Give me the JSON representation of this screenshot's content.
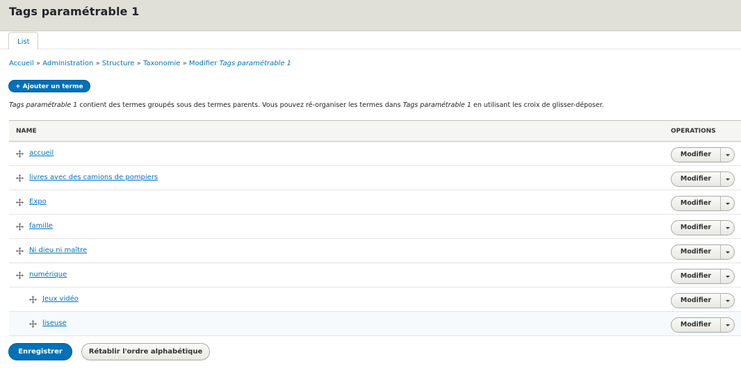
{
  "page": {
    "title": "Tags paramétrable 1"
  },
  "tabs": [
    {
      "label": "List"
    }
  ],
  "breadcrumb": {
    "items": [
      "Accueil",
      "Administration",
      "Structure",
      "Taxonomie",
      "Modifier"
    ],
    "separator": "»",
    "current": "Tags paramétrable 1"
  },
  "actions": {
    "add_term_label": "+ Ajouter un terme"
  },
  "description": {
    "vocab": "Tags paramétrable 1",
    "part1": " contient des termes groupés sous des termes parents. Vous pouvez ré-organiser les termes dans ",
    "part2": " en utilisant les croix de glisser-déposer."
  },
  "table": {
    "headers": {
      "name": "NAME",
      "operations": "OPERATIONS"
    },
    "rows": [
      {
        "name": "accueil",
        "depth": 0,
        "op": "Modifier"
      },
      {
        "name": "livres avec des camions de pompiers",
        "depth": 0,
        "op": "Modifier"
      },
      {
        "name": "Expo",
        "depth": 0,
        "op": "Modifier"
      },
      {
        "name": "famille",
        "depth": 0,
        "op": "Modifier"
      },
      {
        "name": "Ni dieu ni maître",
        "depth": 0,
        "op": "Modifier"
      },
      {
        "name": "numérique",
        "depth": 0,
        "op": "Modifier"
      },
      {
        "name": "Jeux vidéo",
        "depth": 1,
        "op": "Modifier"
      },
      {
        "name": "liseuse",
        "depth": 1,
        "op": "Modifier"
      }
    ]
  },
  "footer": {
    "save_label": "Enregistrer",
    "reset_label": "Rétablir l'ordre alphabétique"
  },
  "colors": {
    "link": "#0074bd",
    "primary": "#0071b8",
    "header_bg": "#e0e0d8"
  }
}
